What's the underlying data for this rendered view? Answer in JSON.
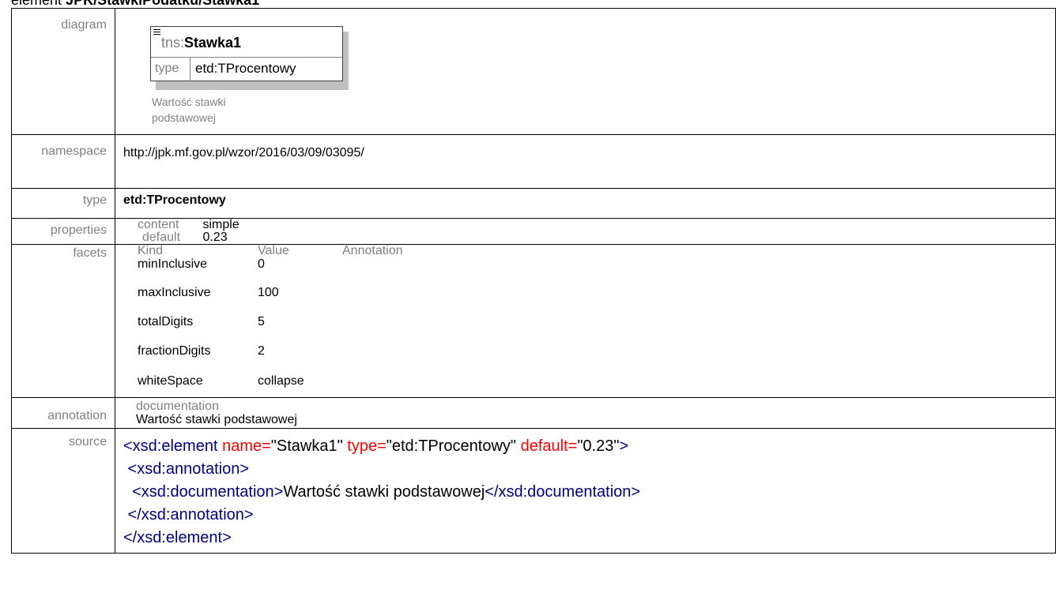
{
  "heading": {
    "prefix": "element",
    "path": "JPK/StawkiPodatku/Stawka1"
  },
  "labels": {
    "diagram": "diagram",
    "namespace": "namespace",
    "type": "type",
    "properties": "properties",
    "facets": "facets",
    "annotation": "annotation",
    "source": "source"
  },
  "diagram": {
    "ns_prefix": "tns:",
    "name": "Stawka1",
    "type_key": "type",
    "type_value": "etd:TProcentowy",
    "note_line1": "Wartość stawki",
    "note_line2": "podstawowej"
  },
  "namespace": "http://jpk.mf.gov.pl/wzor/2016/03/09/03095/",
  "type": "etd:TProcentowy",
  "properties": [
    {
      "key": "content",
      "value": "simple"
    },
    {
      "key": "default",
      "value": "0.23"
    }
  ],
  "facets": {
    "headers": [
      "Kind",
      "Value",
      "Annotation"
    ],
    "rows": [
      {
        "kind": "minInclusive",
        "value": "0"
      },
      {
        "kind": "maxInclusive",
        "value": "100"
      },
      {
        "kind": "totalDigits",
        "value": "5"
      },
      {
        "kind": "fractionDigits",
        "value": "2"
      },
      {
        "kind": "whiteSpace",
        "value": "collapse"
      }
    ]
  },
  "annotation": {
    "header": "documentation",
    "text": "Wartość stawki podstawowej"
  },
  "source": {
    "l1_open": "<xsd:element",
    "l1_a1": " name=",
    "l1_v1": "\"Stawka1\"",
    "l1_a2": " type=",
    "l1_v2": "\"etd:TProcentowy\"",
    "l1_a3": " default=",
    "l1_v3": "\"0.23\"",
    "l1_close": ">",
    "l2": " <xsd:annotation>",
    "l3_open": "  <xsd:documentation>",
    "l3_text": "Wartość stawki podstawowej",
    "l3_close": "</xsd:documentation>",
    "l4": " </xsd:annotation>",
    "l5": "</xsd:element>"
  },
  "colors": {
    "tag": "#000080",
    "attr": "#ff0000",
    "label": "#808080"
  }
}
